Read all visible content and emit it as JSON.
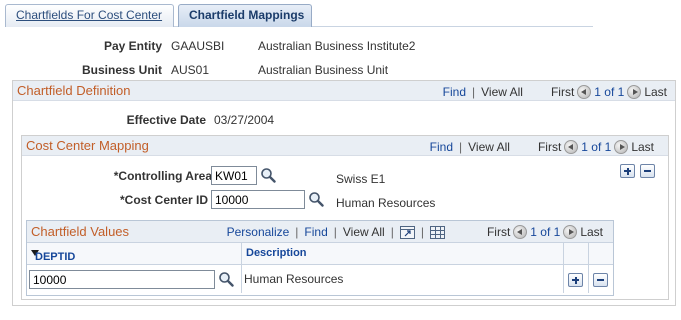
{
  "tabs": [
    {
      "label": "Chartfields For Cost Center",
      "active": false
    },
    {
      "label": "Chartfield Mappings",
      "active": true
    }
  ],
  "header": {
    "pay_entity_label": "Pay Entity",
    "pay_entity_code": "GAAUSBI",
    "pay_entity_desc": "Australian Business Institute2",
    "business_unit_label": "Business Unit",
    "business_unit_code": "AUS01",
    "business_unit_desc": "Australian Business Unit"
  },
  "chartfield_definition": {
    "title": "Chartfield Definition",
    "nav": {
      "find": "Find",
      "sep": "|",
      "view_all": "View All",
      "first": "First",
      "count": "1 of 1",
      "last": "Last"
    },
    "effective_date_label": "Effective Date",
    "effective_date_value": "03/27/2004"
  },
  "cost_center_mapping": {
    "title": "Cost Center Mapping",
    "nav": {
      "find": "Find",
      "sep": "|",
      "view_all": "View All",
      "first": "First",
      "count": "1 of 1",
      "last": "Last"
    },
    "controlling_area_label": "*Controlling Area",
    "controlling_area_value": "KW01",
    "controlling_area_desc": "Swiss E1",
    "cost_center_label": "*Cost Center ID",
    "cost_center_value": "10000",
    "cost_center_desc": "Human Resources"
  },
  "chartfield_values": {
    "title": "Chartfield Values",
    "nav": {
      "personalize": "Personalize",
      "sep": "|",
      "find": "Find",
      "view_all": "View All",
      "first": "First",
      "count": "1 of 1",
      "last": "Last"
    },
    "columns": [
      "DEPTID",
      "Description"
    ],
    "rows": [
      {
        "deptid": "10000",
        "description": "Human Resources"
      }
    ]
  },
  "colors": {
    "accent_title": "#c25e28",
    "link": "#16479a",
    "header_bg": "#e9eef4"
  },
  "icons": [
    "lookup-icon",
    "prev-arrow-icon",
    "next-arrow-icon",
    "add-row-icon",
    "delete-row-icon",
    "sort-desc-icon",
    "zoom-grid-icon",
    "download-grid-icon"
  ]
}
